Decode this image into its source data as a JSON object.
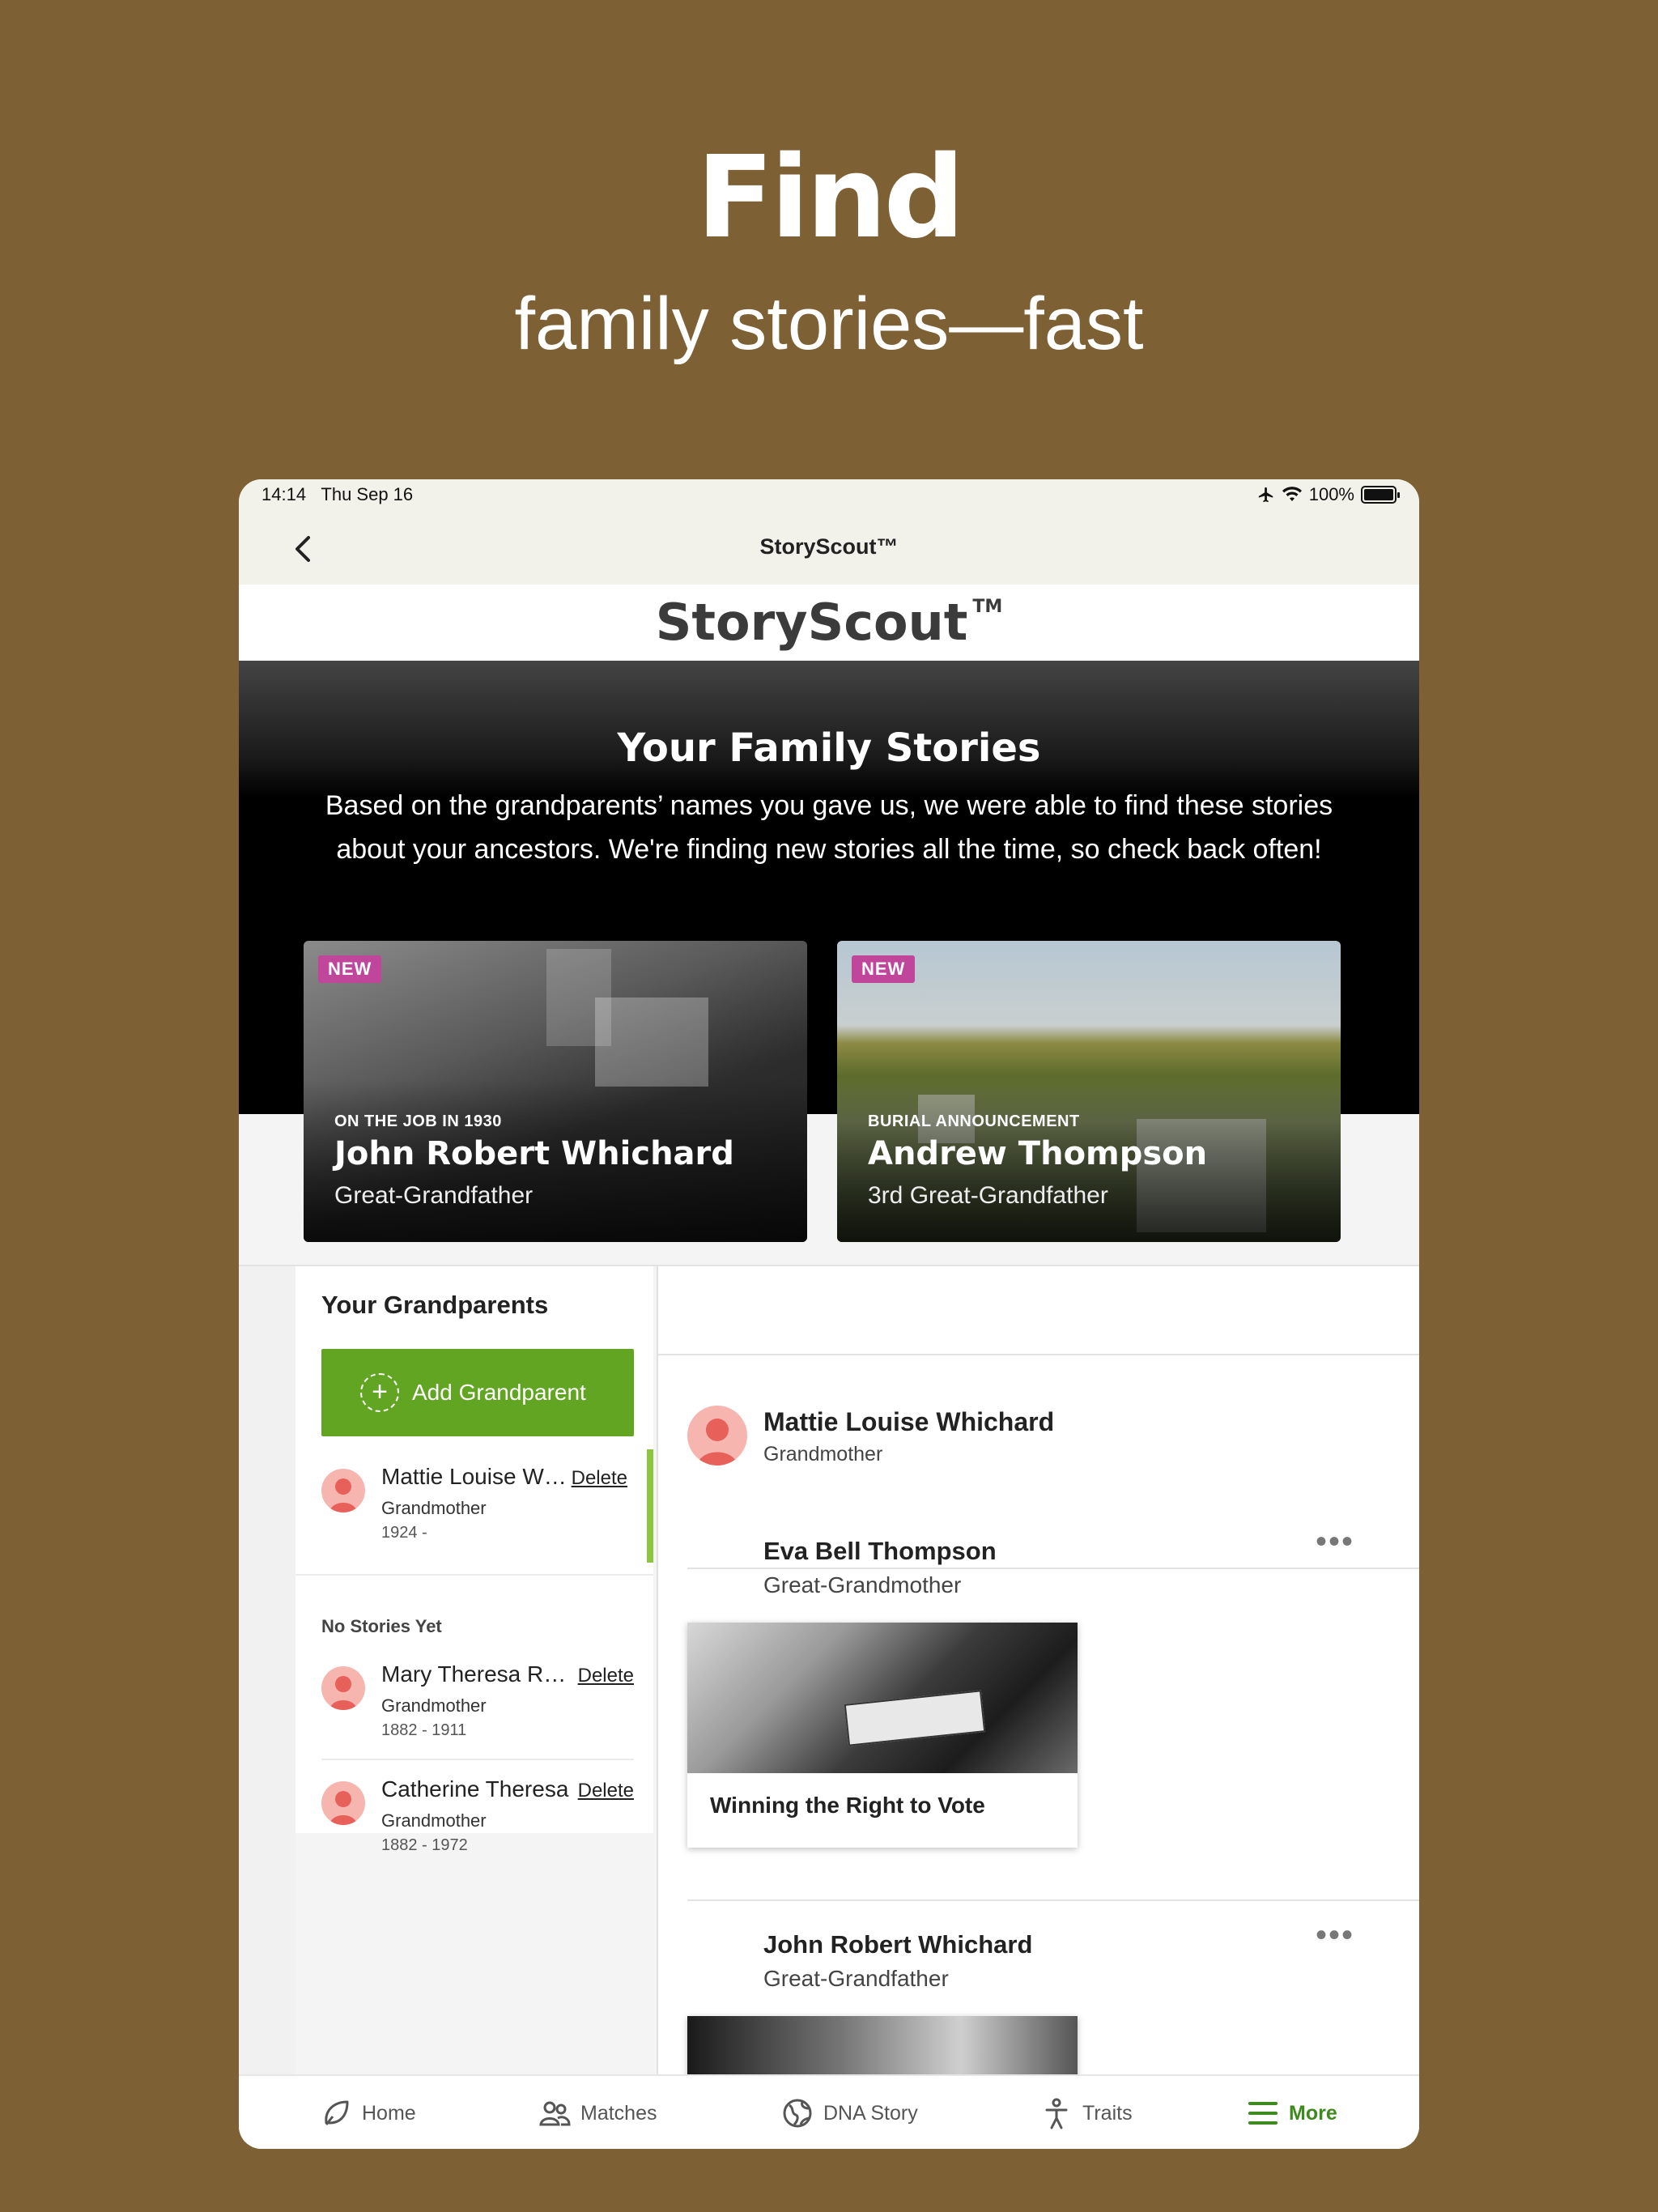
{
  "promo": {
    "title": "Find",
    "subtitle": "family stories—fast"
  },
  "status_bar": {
    "time": "14:14",
    "date": "Thu Sep 16",
    "battery": "100%",
    "battery_level": 1.0
  },
  "nav": {
    "title": "StoryScout™"
  },
  "brand": {
    "logo": "StoryScout",
    "tm": "TM"
  },
  "hero": {
    "title": "Your Family Stories",
    "description": "Based on the grandparents’ names you gave us, we were able to find these stories about your ancestors. We're finding new stories all the time, so check back often!"
  },
  "featured_stories": [
    {
      "badge": "NEW",
      "kicker": "ON THE JOB IN 1930",
      "name": "John Robert Whichard",
      "relation": "Great-Grandfather"
    },
    {
      "badge": "NEW",
      "kicker": "BURIAL ANNOUNCEMENT",
      "name": "Andrew Thompson",
      "relation": "3rd Great-Grandfather"
    }
  ],
  "grandparents": {
    "heading": "Your Grandparents",
    "add_label": "Add Grandparent",
    "delete_label": "Delete",
    "with_stories": [
      {
        "name": "Mattie Louise Whichard",
        "relation": "Grandmother",
        "years": "1924 -"
      }
    ],
    "no_stories_heading": "No Stories Yet",
    "no_stories": [
      {
        "name": "Mary Theresa Ross",
        "relation": "Grandmother",
        "years": "1882 - 1911"
      },
      {
        "name": "Catherine Theresa",
        "relation": "Grandmother",
        "years": "1882 - 1972"
      }
    ]
  },
  "detail": {
    "selected_name": "Mattie Louise Whichard",
    "selected_relation": "Grandmother",
    "ancestors": [
      {
        "name": "Eva Bell Thompson",
        "relation": "Great-Grandmother",
        "story_title": "Winning the Right to Vote"
      },
      {
        "name": "John Robert Whichard",
        "relation": "Great-Grandfather"
      }
    ]
  },
  "tabs": [
    {
      "label": "Home",
      "icon": "home-leaf-icon"
    },
    {
      "label": "Matches",
      "icon": "people-icon"
    },
    {
      "label": "DNA Story",
      "icon": "globe-icon"
    },
    {
      "label": "Traits",
      "icon": "person-icon"
    },
    {
      "label": "More",
      "icon": "menu-icon",
      "active": true
    }
  ],
  "colors": {
    "background": "#7e6035",
    "accent_green": "#62a523",
    "active_tab": "#3f8a1e",
    "badge_new": "#c0469b",
    "selected_indicator": "#8cc63f"
  }
}
